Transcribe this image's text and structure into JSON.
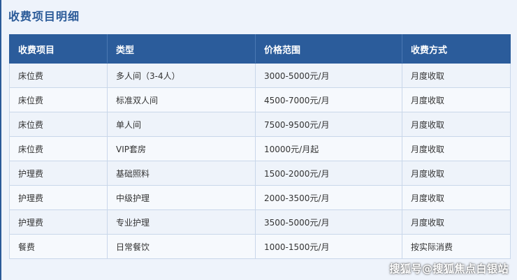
{
  "title": "收费项目明细",
  "table": {
    "headers": [
      "收费项目",
      "类型",
      "价格范围",
      "收费方式"
    ],
    "rows": [
      [
        "床位费",
        "多人间（3-4人）",
        "3000-5000元/月",
        "月度收取"
      ],
      [
        "床位费",
        "标准双人间",
        "4500-7000元/月",
        "月度收取"
      ],
      [
        "床位费",
        "单人间",
        "7500-9500元/月",
        "月度收取"
      ],
      [
        "床位费",
        "VIP套房",
        "10000元/月起",
        "月度收取"
      ],
      [
        "护理费",
        "基础照料",
        "1500-2000元/月",
        "月度收取"
      ],
      [
        "护理费",
        "中级护理",
        "2000-3500元/月",
        "月度收取"
      ],
      [
        "护理费",
        "专业护理",
        "3500-5000元/月",
        "月度收取"
      ],
      [
        "餐费",
        "日常餐饮",
        "1000-1500元/月",
        "按实际消费"
      ]
    ]
  },
  "watermark": "搜狐号@搜狐焦点白银站",
  "colors": {
    "header_bg": "#2b5c9b",
    "title": "#2a5a98",
    "row_bg": "#f6f9fd",
    "row_alt_bg": "#eef3fa"
  }
}
